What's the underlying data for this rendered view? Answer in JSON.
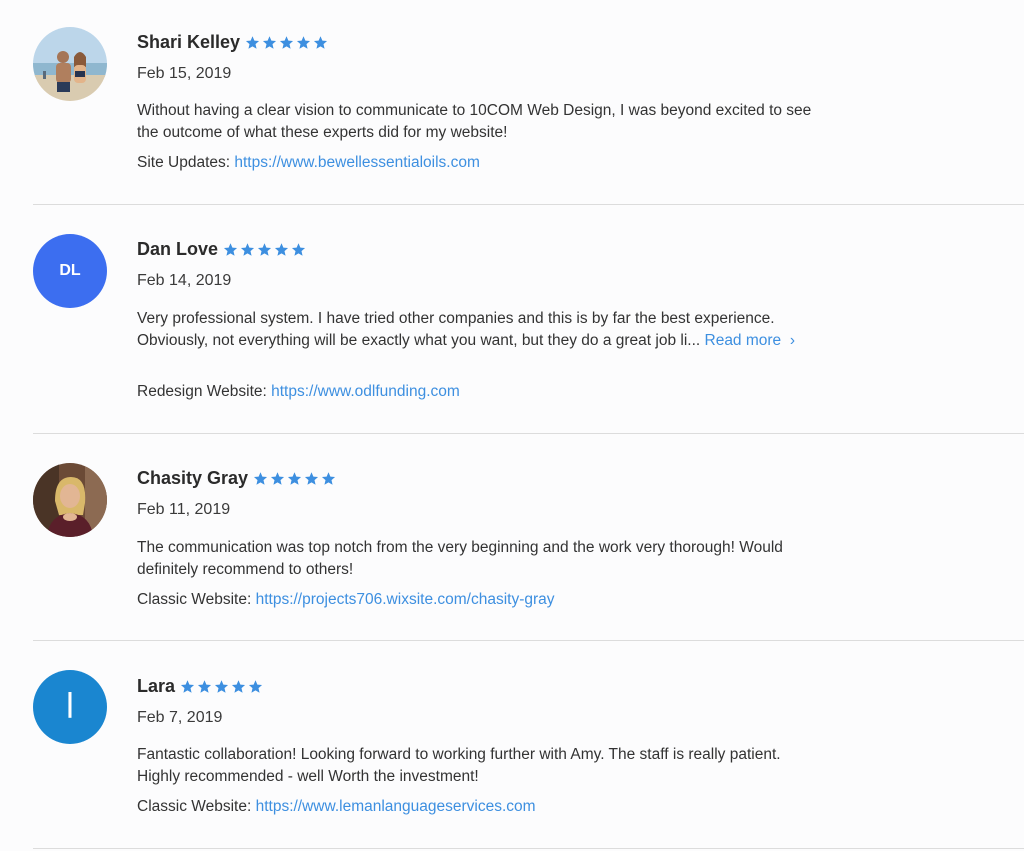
{
  "reviews": [
    {
      "name": "Shari Kelley",
      "rating": 5,
      "date": "Feb 15, 2019",
      "text": "Without having a clear vision to communicate to 10COM Web Design, I was beyond excited to see the outcome of what these experts did for my website!",
      "site_label": "Site Updates:",
      "site_url": "https://www.bewellessentialoils.com",
      "avatar": {
        "type": "photo",
        "desc": "beach-couple-photo"
      }
    },
    {
      "name": "Dan Love",
      "rating": 5,
      "date": "Feb 14, 2019",
      "text": "Very professional system.  I have tried other companies and this is by far the best experience.  Obviously, not everything will be exactly what you want, but they do a great job li...",
      "read_more": "Read more",
      "site_label": "Redesign Website:",
      "site_url": "https://www.odlfunding.com",
      "avatar": {
        "type": "initials",
        "initials": "DL",
        "color": "#3c6ef0"
      }
    },
    {
      "name": "Chasity Gray",
      "rating": 5,
      "date": "Feb 11, 2019",
      "text": "The communication was top notch from the very beginning and the work very thorough! Would definitely recommend to others!",
      "site_label": "Classic Website:",
      "site_url": "https://projects706.wixsite.com/chasity-gray",
      "avatar": {
        "type": "photo",
        "desc": "woman-portrait-photo"
      }
    },
    {
      "name": "Lara",
      "rating": 5,
      "date": "Feb 7, 2019",
      "text": "Fantastic collaboration! Looking forward to working further with Amy. The staff is really patient. Highly recommended - well Worth the investment!",
      "site_label": "Classic Website:",
      "site_url": "https://www.lemanlanguageservices.com",
      "avatar": {
        "type": "initials",
        "initials": "l",
        "color": "#1a86d0"
      }
    }
  ],
  "colors": {
    "star": "#3d8fe0",
    "link": "#3d8fe0",
    "divider": "#dcdcdc"
  }
}
